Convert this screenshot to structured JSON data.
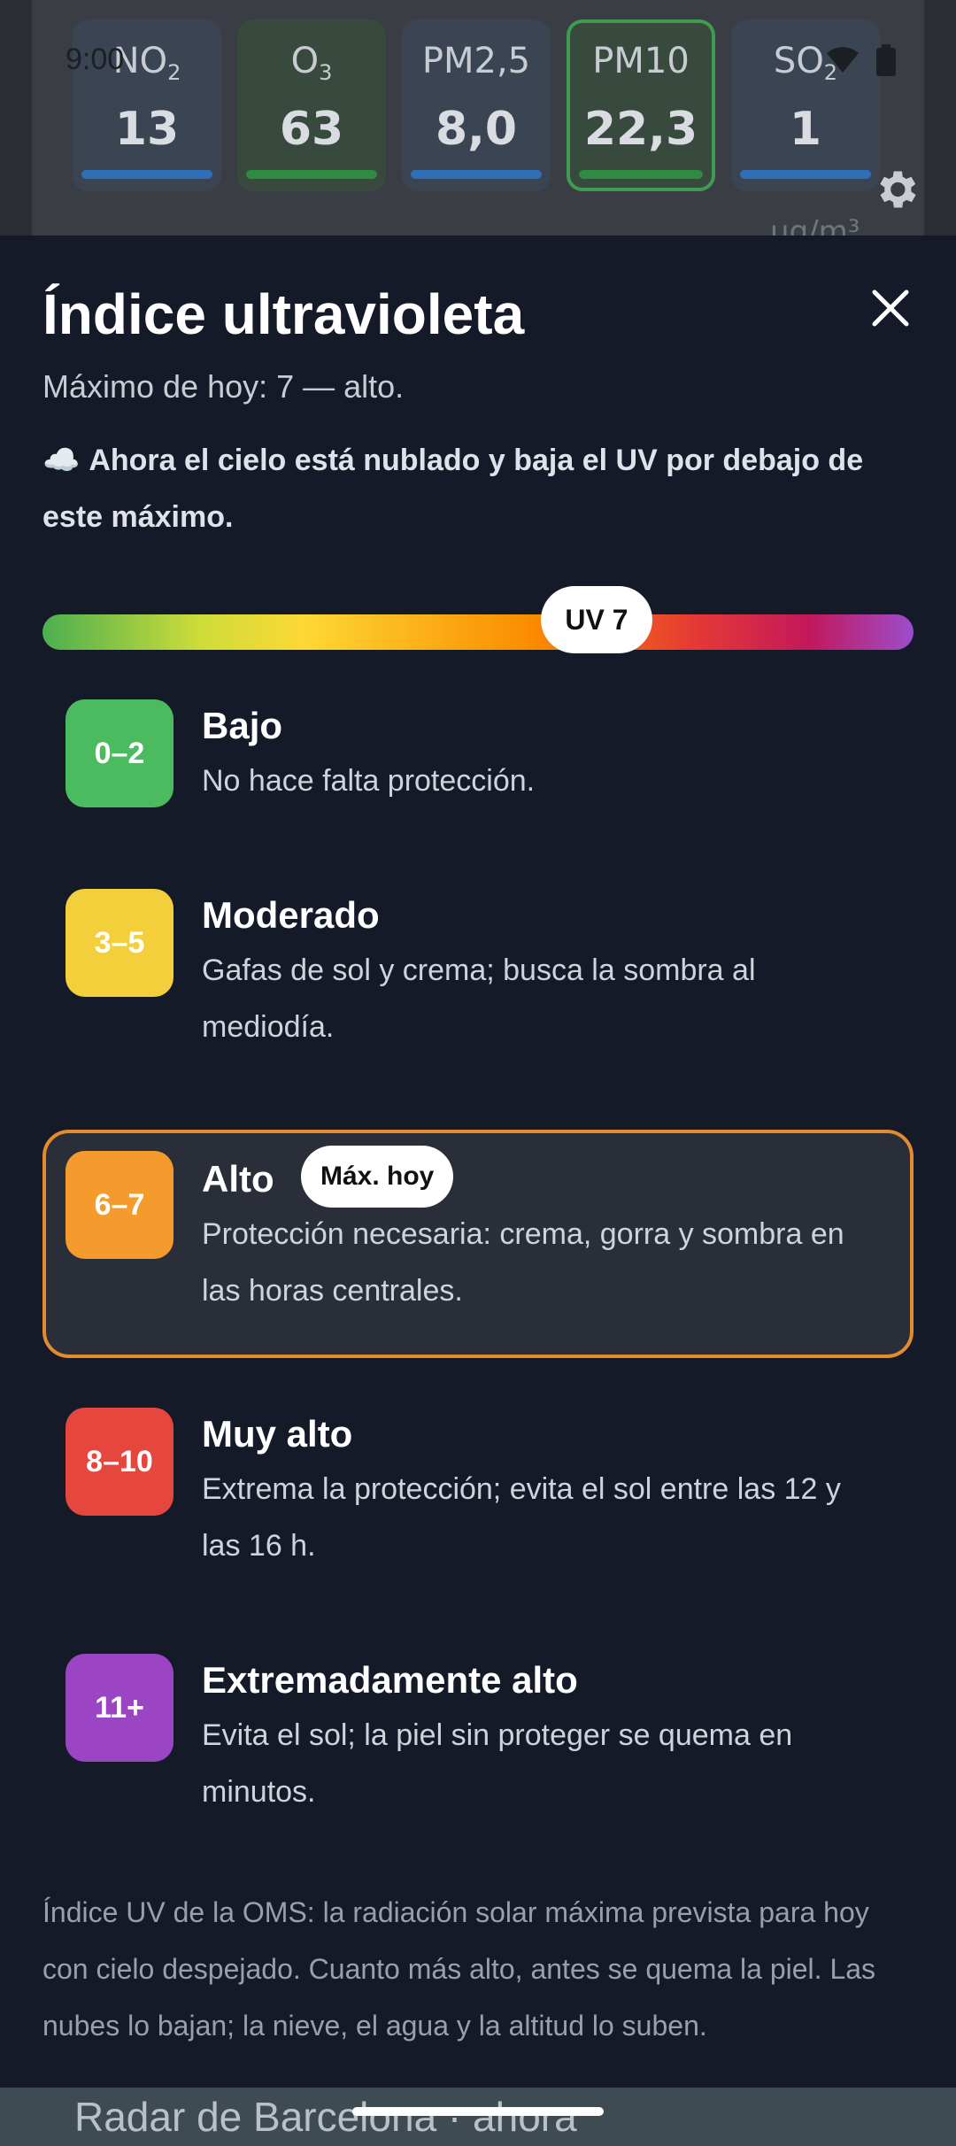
{
  "status_bar": {
    "time": "9:00"
  },
  "pollutants": [
    {
      "name": "NO",
      "sub": "2",
      "value": "13",
      "bar": "blue"
    },
    {
      "name": "O",
      "sub": "3",
      "value": "63",
      "bar": "green"
    },
    {
      "name": "PM2,5",
      "sub": "",
      "value": "8,0",
      "bar": "blue"
    },
    {
      "name": "PM10",
      "sub": "",
      "value": "22,3",
      "bar": "green"
    },
    {
      "name": "SO",
      "sub": "2",
      "value": "1",
      "bar": "blue"
    }
  ],
  "background_unit": "µg/m³",
  "sheet": {
    "title": "Índice ultravioleta",
    "subtitle": "Máximo de hoy: 7 — alto.",
    "cloud_icon": "☁️",
    "cloud_note": "Ahora el cielo está nublado y baja el UV por debajo de este máximo.",
    "uv_marker": "UV 7",
    "uv_value": 7,
    "uv_scale_max": 11,
    "levels": [
      {
        "range": "0–2",
        "name": "Bajo",
        "desc": "No hace falta protección.",
        "color": "#4cbb5f"
      },
      {
        "range": "3–5",
        "name": "Moderado",
        "desc": "Gafas de sol y crema; busca la sombra al mediodía.",
        "color": "#f2cf3b"
      },
      {
        "range": "6–7",
        "name": "Alto",
        "desc": "Protección necesaria: crema, gorra y sombra en las horas centrales.",
        "color": "#f59a2c",
        "tag": "Máx. hoy"
      },
      {
        "range": "8–10",
        "name": "Muy alto",
        "desc": "Extrema la protección; evita el sol entre las 12 y las 16 h.",
        "color": "#e5473e"
      },
      {
        "range": "11+",
        "name": "Extremadamente alto",
        "desc": "Evita el sol; la piel sin proteger se quema en minutos.",
        "color": "#9b44c4"
      }
    ],
    "footnote": "Índice UV de la OMS: la radiación solar máxima prevista para hoy con cielo despejado. Cuanto más alto, antes se quema la piel. Las nubes lo bajan; la nieve, el agua y la altitud lo suben."
  },
  "map": {
    "title": "Radar de Barcelona · ahora"
  }
}
